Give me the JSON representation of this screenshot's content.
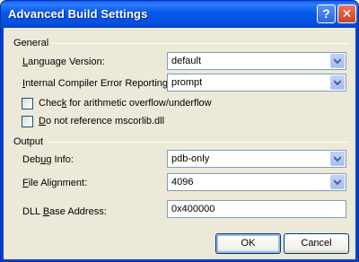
{
  "window": {
    "title": "Advanced Build Settings",
    "help_glyph": "?",
    "close_glyph": "✕"
  },
  "general": {
    "group_label": "General",
    "language_version": {
      "label_mnemonic": "L",
      "label_rest": "anguage Version:",
      "value": "default"
    },
    "internal_compiler_error": {
      "label_mnemonic": "I",
      "label_rest": "nternal Compiler Error Reporting:",
      "value": "prompt"
    },
    "check_overflow": {
      "label_pre": "Chec",
      "label_mnemonic": "k",
      "label_rest": " for arithmetic overflow/underflow",
      "checked": false
    },
    "no_mscorlib": {
      "label_mnemonic": "D",
      "label_rest": "o not reference mscorlib.dll",
      "checked": false
    }
  },
  "output": {
    "group_label": "Output",
    "debug_info": {
      "label_pre": "Deb",
      "label_mnemonic": "u",
      "label_rest": "g Info:",
      "value": "pdb-only"
    },
    "file_alignment": {
      "label_mnemonic": "F",
      "label_rest": "ile Alignment:",
      "value": "4096"
    },
    "dll_base_address": {
      "label_pre": "DLL ",
      "label_mnemonic": "B",
      "label_rest": "ase Address:",
      "value": "0x400000"
    }
  },
  "buttons": {
    "ok": "OK",
    "cancel": "Cancel"
  },
  "icons": {
    "help": "help-icon",
    "close": "close-icon",
    "dropdown": "chevron-down-icon"
  }
}
